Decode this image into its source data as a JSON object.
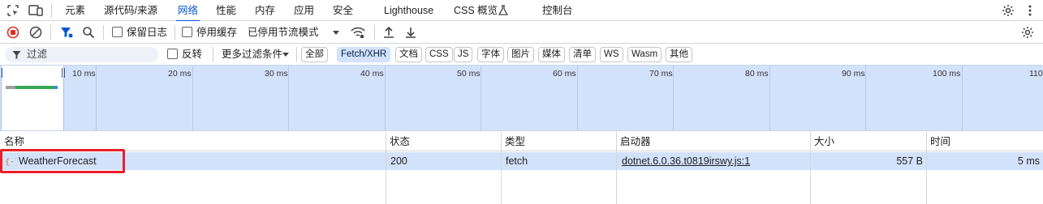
{
  "tabbar": {
    "tabs": [
      "元素",
      "源代码/来源",
      "网络",
      "性能",
      "内存",
      "应用",
      "安全",
      "Lighthouse",
      "CSS 概览",
      "控制台"
    ],
    "active_tab": "网络",
    "icons": [
      "inspect-element-icon",
      "device-toolbar-icon",
      "flask-icon",
      "settings-icon",
      "more-vertical-icon"
    ]
  },
  "toolbar": {
    "preserve_log": "保留日志",
    "disable_cache": "停用缓存",
    "throttling": "已停用节流模式",
    "icons": [
      "record-stop-icon",
      "clear-icon",
      "filter-icon",
      "search-icon",
      "network-conditions-icon",
      "import-icon",
      "export-icon",
      "settings-icon"
    ]
  },
  "filterbar": {
    "placeholder": "过滤",
    "invert": "反转",
    "more_filters": "更多过滤条件",
    "chips": [
      "全部",
      "Fetch/XHR",
      "文档",
      "CSS",
      "JS",
      "字体",
      "图片",
      "媒体",
      "清单",
      "WS",
      "Wasm",
      "其他"
    ],
    "active_chip": "Fetch/XHR"
  },
  "overview": {
    "ticks": [
      "10 ms",
      "20 ms",
      "30 ms",
      "40 ms",
      "50 ms",
      "60 ms",
      "70 ms",
      "80 ms",
      "90 ms",
      "100 ms",
      "110"
    ]
  },
  "table": {
    "columns": [
      "名称",
      "状态",
      "类型",
      "启动器",
      "大小",
      "时间"
    ],
    "rows": [
      {
        "name": "WeatherForecast",
        "status": "200",
        "type": "fetch",
        "initiator": "dotnet.6.0.36.t0819irswy.js:1",
        "size": "557 B",
        "time": "5 ms"
      }
    ]
  },
  "colors": {
    "accent": "#0b57d0",
    "selected_row": "#d3e2fb",
    "highlight_box": "#e8202a",
    "record_red": "#d93025"
  }
}
